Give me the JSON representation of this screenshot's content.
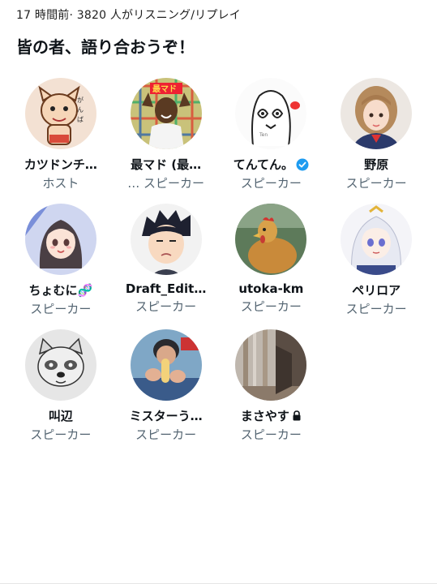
{
  "header": {
    "meta": "17 時間前· 3820 人がリスニング/リプレイ",
    "title": "皆の者、語り合おうぞ！"
  },
  "participants": [
    {
      "name": "カツドンチ…",
      "role": "ホスト",
      "avatar_icon": "cartoon-cat-avatar-icon"
    },
    {
      "name": "最マド (最…",
      "role": "… スピーカー",
      "avatar_icon": "man-plaid-avatar-icon"
    },
    {
      "name": "てんてん。",
      "role": "スピーカー",
      "avatar_icon": "ghost-drawing-avatar-icon",
      "verified": true
    },
    {
      "name": "野原",
      "role": "スピーカー",
      "avatar_icon": "girl-photo-avatar-icon"
    },
    {
      "name": "ちょむに🧬",
      "role": "スピーカー",
      "avatar_icon": "anime-girl-avatar-icon"
    },
    {
      "name": "Draft_Edit…",
      "role": "スピーカー",
      "avatar_icon": "anime-man-avatar-icon"
    },
    {
      "name": "utoka-km",
      "role": "スピーカー",
      "avatar_icon": "chicken-avatar-icon"
    },
    {
      "name": "ペリロア",
      "role": "スピーカー",
      "avatar_icon": "white-hair-anime-avatar-icon"
    },
    {
      "name": "叫辺",
      "role": "スピーカー",
      "avatar_icon": "raccoon-sketch-avatar-icon"
    },
    {
      "name": "ミスターう…",
      "role": "スピーカー",
      "avatar_icon": "person-holding-food-avatar-icon"
    },
    {
      "name": "まさやす",
      "role": "スピーカー",
      "avatar_icon": "room-photo-avatar-icon",
      "locked": true
    }
  ],
  "colors": {
    "verified": "#1d9bf0",
    "secondary_text": "#536471"
  }
}
